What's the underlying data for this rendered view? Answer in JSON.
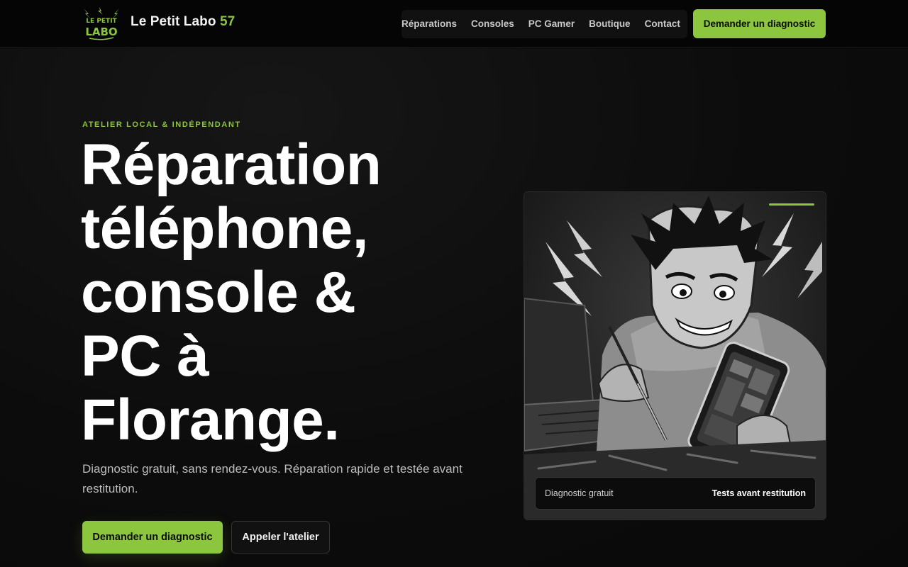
{
  "brand": {
    "logo_text_top": "LE PETIT",
    "logo_text_bottom": "LABO",
    "name": "Le Petit Labo",
    "number": "57"
  },
  "nav": {
    "items": [
      {
        "label": "Réparations"
      },
      {
        "label": "Consoles"
      },
      {
        "label": "PC Gamer"
      },
      {
        "label": "Boutique"
      },
      {
        "label": "Contact"
      }
    ],
    "cta_label": "Demander un diagnostic"
  },
  "hero": {
    "eyebrow": "ATELIER LOCAL & INDÉPENDANT",
    "title_lines": [
      "Réparation",
      "téléphone,",
      "console &",
      "PC à",
      "Florange."
    ],
    "subtitle": "Diagnostic gratuit, sans rendez-vous. Réparation rapide et testée avant restitution.",
    "primary_cta": "Demander un diagnostic",
    "secondary_cta": "Appeler l'atelier"
  },
  "card": {
    "footer_left": "Diagnostic gratuit",
    "footer_right": "Tests avant restitution"
  },
  "colors": {
    "accent": "#8cc63f",
    "background": "#0d0d0d",
    "header": "#050505"
  },
  "icons": {
    "logo": "lightning-logo-icon"
  }
}
